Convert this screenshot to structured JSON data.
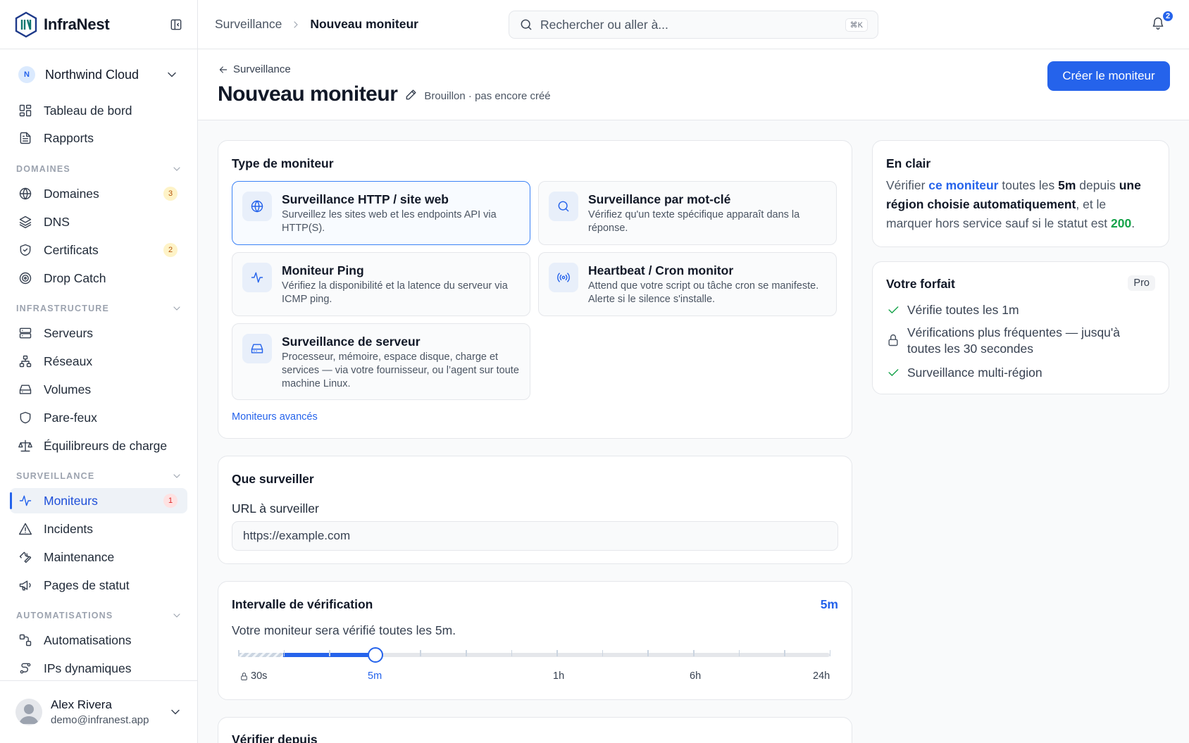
{
  "brand": {
    "name": "InfraNest",
    "logo_icon": "infranest-logo"
  },
  "org": {
    "initial": "N",
    "name": "Northwind Cloud"
  },
  "nav": {
    "top": [
      {
        "label": "Tableau de bord",
        "icon": "dashboard-icon"
      },
      {
        "label": "Rapports",
        "icon": "report-icon"
      }
    ],
    "sections": [
      {
        "title": "DOMAINES",
        "items": [
          {
            "label": "Domaines",
            "icon": "globe-icon",
            "badge": "3"
          },
          {
            "label": "DNS",
            "icon": "layers-icon"
          },
          {
            "label": "Certificats",
            "icon": "shield-check-icon",
            "badge": "2"
          },
          {
            "label": "Drop Catch",
            "icon": "target-icon"
          }
        ]
      },
      {
        "title": "INFRASTRUCTURE",
        "items": [
          {
            "label": "Serveurs",
            "icon": "server-icon"
          },
          {
            "label": "Réseaux",
            "icon": "network-icon"
          },
          {
            "label": "Volumes",
            "icon": "drive-icon"
          },
          {
            "label": "Pare-feux",
            "icon": "shield-icon"
          },
          {
            "label": "Équilibreurs de charge",
            "icon": "scale-icon"
          }
        ]
      },
      {
        "title": "SURVEILLANCE",
        "items": [
          {
            "label": "Moniteurs",
            "icon": "activity-icon",
            "badge": "1",
            "active": true
          },
          {
            "label": "Incidents",
            "icon": "alert-icon"
          },
          {
            "label": "Maintenance",
            "icon": "wrench-icon"
          },
          {
            "label": "Pages de statut",
            "icon": "megaphone-icon"
          }
        ]
      },
      {
        "title": "AUTOMATISATIONS",
        "items": [
          {
            "label": "Automatisations",
            "icon": "workflow-icon"
          },
          {
            "label": "IPs dynamiques",
            "icon": "dynamic-ip-icon"
          }
        ]
      }
    ]
  },
  "user": {
    "name": "Alex Rivera",
    "email": "demo@infranest.app"
  },
  "topbar": {
    "crumb_parent": "Surveillance",
    "crumb_current": "Nouveau moniteur",
    "search_placeholder": "Rechercher ou aller à...",
    "search_shortcut": "⌘K",
    "notifications_count": "2"
  },
  "page": {
    "back_label": "Surveillance",
    "title": "Nouveau moniteur",
    "status": "Brouillon · pas encore créé",
    "create_button": "Créer le moniteur"
  },
  "monitor_type": {
    "title": "Type de moniteur",
    "options": [
      {
        "title": "Surveillance HTTP / site web",
        "desc": "Surveillez les sites web et les endpoints API via HTTP(S).",
        "icon": "globe-icon",
        "selected": true
      },
      {
        "title": "Surveillance par mot-clé",
        "desc": "Vérifiez qu'un texte spécifique apparaît dans la réponse.",
        "icon": "search-icon"
      },
      {
        "title": "Moniteur Ping",
        "desc": "Vérifiez la disponibilité et la latence du serveur via ICMP ping.",
        "icon": "pulse-icon"
      },
      {
        "title": "Heartbeat / Cron monitor",
        "desc": "Attend que votre script ou tâche cron se manifeste. Alerte si le silence s'installe.",
        "icon": "broadcast-icon"
      },
      {
        "title": "Surveillance de serveur",
        "desc": "Processeur, mémoire, espace disque, charge et services — via votre fournisseur, ou l’agent sur toute machine Linux.",
        "icon": "hard-drive-icon"
      }
    ],
    "advanced_link": "Moniteurs avancés"
  },
  "what_to_monitor": {
    "title": "Que surveiller",
    "url_label": "URL à surveiller",
    "url_value": "https://example.com"
  },
  "interval": {
    "title": "Intervalle de vérification",
    "value": "5m",
    "description": "Votre moniteur sera vérifié toutes les 5m.",
    "labels": [
      "30s",
      "5m",
      "1h",
      "6h",
      "24h"
    ],
    "selected_label": "5m",
    "locked_label": "30s"
  },
  "check_from": {
    "title": "Vérifier depuis"
  },
  "plain_language": {
    "title": "En clair",
    "p1": "Vérifier ",
    "link": "ce moniteur",
    "p2": " toutes les ",
    "interval": "5m",
    "p3": " depuis ",
    "region": "une région choisie automatiquement",
    "p4": ", et le marquer hors service sauf si le statut est ",
    "status": "200",
    "p5": "."
  },
  "plan": {
    "title": "Votre forfait",
    "badge": "Pro",
    "items": [
      {
        "text": "Vérifie toutes les 1m",
        "icon": "check-icon"
      },
      {
        "text": "Vérifications plus fréquentes — jusqu'à toutes les 30 secondes",
        "icon": "lock-icon"
      },
      {
        "text": "Surveillance multi-région",
        "icon": "check-icon"
      }
    ]
  },
  "colors": {
    "accent": "#2563eb",
    "success": "#16a34a",
    "warning_badge": "#fef3c7",
    "danger_badge": "#fee2e2"
  }
}
